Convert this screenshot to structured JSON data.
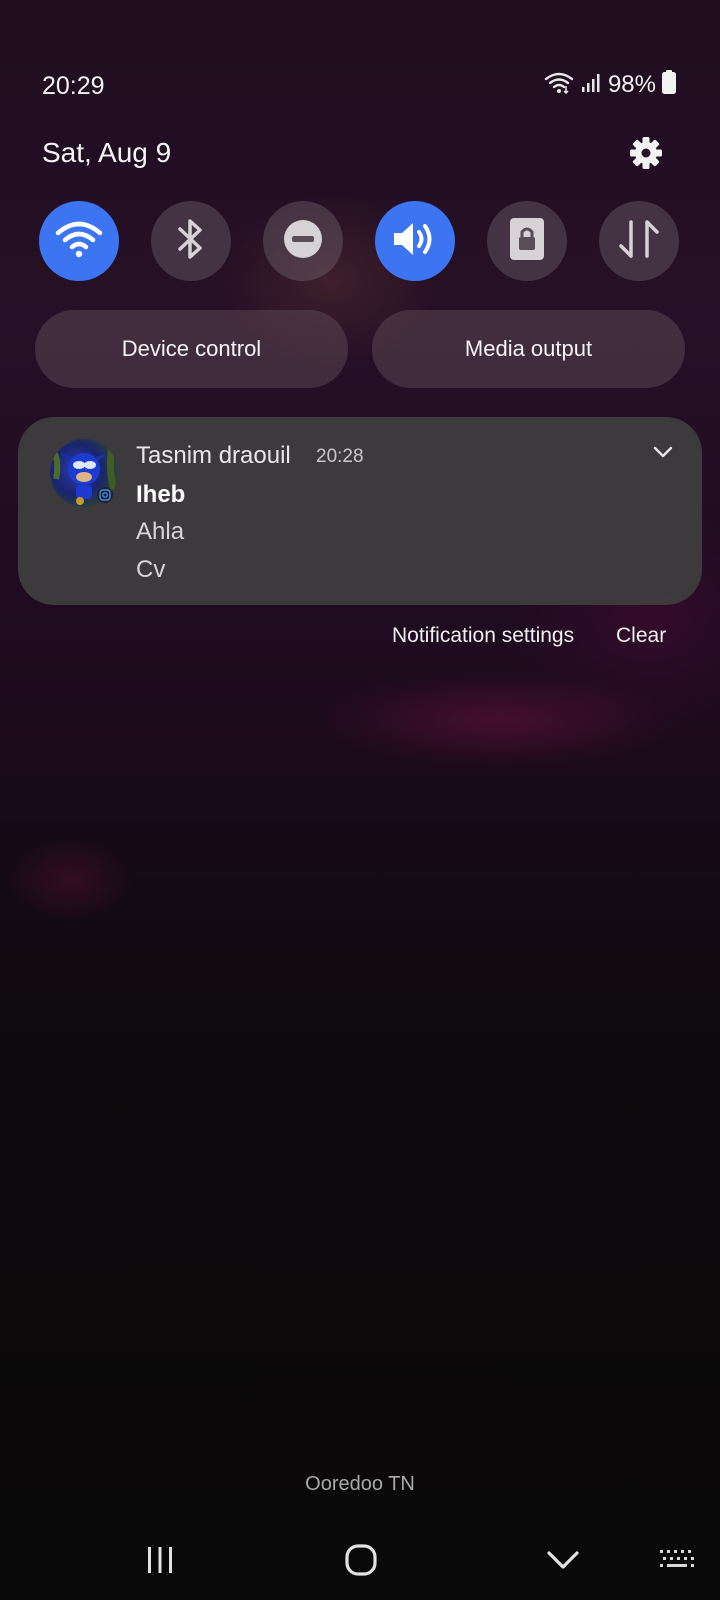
{
  "status_bar": {
    "time": "20:29",
    "battery": "98%",
    "icons": [
      "wifi-icon",
      "signal-icon",
      "battery-icon"
    ]
  },
  "header": {
    "date": "Sat, Aug 9",
    "settings_icon": "gear-icon"
  },
  "quick_toggles": [
    {
      "name": "wifi",
      "icon": "wifi-icon",
      "on": true
    },
    {
      "name": "bluetooth",
      "icon": "bluetooth-icon",
      "on": false
    },
    {
      "name": "do-not-disturb",
      "icon": "minus-circle-icon",
      "on": false
    },
    {
      "name": "sound",
      "icon": "speaker-icon",
      "on": true
    },
    {
      "name": "rotation-lock",
      "icon": "lock-icon",
      "on": false
    },
    {
      "name": "mobile-data",
      "icon": "data-arrows-icon",
      "on": false
    }
  ],
  "pills": {
    "device_control": "Device control",
    "media_output": "Media output"
  },
  "notification": {
    "sender": "Tasnim draouil",
    "time": "20:28",
    "title": "Iheb",
    "lines": [
      "Ahla",
      "Cv"
    ],
    "app_badge_icon": "instagram-icon"
  },
  "actions": {
    "settings": "Notification settings",
    "clear": "Clear"
  },
  "carrier": "Ooredoo TN",
  "nav": [
    "recents-icon",
    "home-icon",
    "back-icon",
    "keyboard-icon"
  ],
  "colors": {
    "accent": "#3d74f2",
    "card": "#3e3c3f"
  }
}
